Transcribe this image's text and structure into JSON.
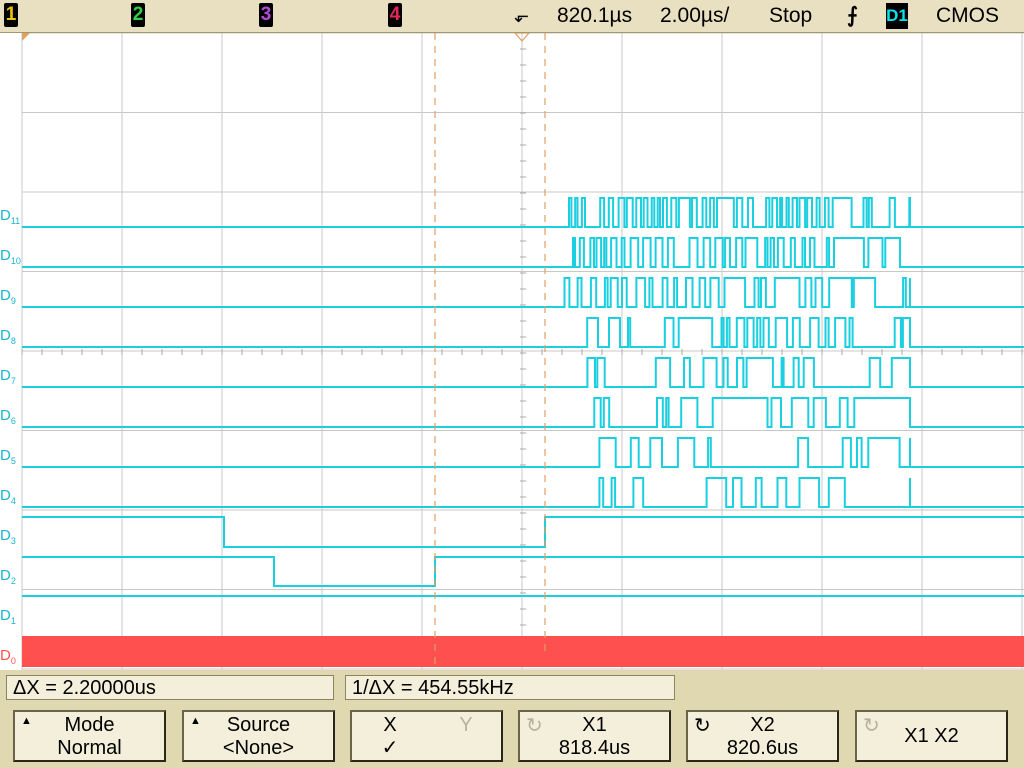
{
  "topbar": {
    "channels": [
      {
        "label": "1",
        "color": "#e8c500"
      },
      {
        "label": "2",
        "color": "#2fd14a"
      },
      {
        "label": "3",
        "color": "#b34bd6"
      },
      {
        "label": "4",
        "color": "#e2265a"
      }
    ],
    "time_position": "820.1µs",
    "time_scale": "2.00µs/",
    "run_state": "Stop",
    "trigger_source": "D1",
    "logic_threshold": "CMOS"
  },
  "digital_channels": [
    {
      "name": "D",
      "index": "11"
    },
    {
      "name": "D",
      "index": "10"
    },
    {
      "name": "D",
      "index": "9"
    },
    {
      "name": "D",
      "index": "8"
    },
    {
      "name": "D",
      "index": "7"
    },
    {
      "name": "D",
      "index": "6"
    },
    {
      "name": "D",
      "index": "5"
    },
    {
      "name": "D",
      "index": "4"
    },
    {
      "name": "D",
      "index": "3"
    },
    {
      "name": "D",
      "index": "2"
    },
    {
      "name": "D",
      "index": "1"
    },
    {
      "name": "D",
      "index": "0"
    }
  ],
  "readouts": {
    "delta_x": "ΔX = 2.20000us",
    "inverse_delta_x": "1/ΔX = 454.55kHz"
  },
  "softkeys": {
    "mode": {
      "line1": "Mode",
      "line2": "Normal"
    },
    "source": {
      "line1": "Source",
      "line2": "<None>"
    },
    "xy": {
      "x": "X",
      "y": "Y",
      "check": "✓"
    },
    "x1": {
      "line1": "X1",
      "line2": "818.4us"
    },
    "x2": {
      "line1": "X2",
      "line2": "820.6us"
    },
    "x1x2": {
      "line1": "X1 X2"
    }
  },
  "colors": {
    "trace": "#19cfe0",
    "d0_bar": "#ff5050",
    "cursor": "#e0a060",
    "grid": "#c8c8c8"
  }
}
